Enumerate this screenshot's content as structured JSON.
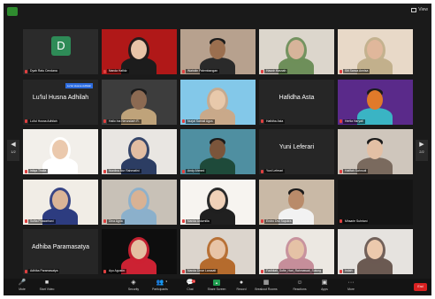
{
  "topbar": {
    "view_label": "View"
  },
  "tiles": [
    {
      "name": "Dyah Ratu Cendana",
      "style": "avatar",
      "avatar_letter": "D",
      "avatar_color": "#2e8b57"
    },
    {
      "name": "Nanda Hafidz",
      "style": "video",
      "bg": "#b01818",
      "skin": "#e7c4a8",
      "cloth": "#1c1c1c",
      "hijab": true
    },
    {
      "name": "Wahidin Palembangan",
      "style": "video",
      "bg": "#b7a18e",
      "skin": "#9b6f4f",
      "cloth": "#2a2a2a"
    },
    {
      "name": "Hasnir Hasnah",
      "style": "video",
      "bg": "#dcd6cc",
      "skin": "#d7b49a",
      "cloth": "#6e8f5a",
      "hijab": true
    },
    {
      "name": "Siti Sanca Annisa",
      "style": "video",
      "bg": "#e8d9c8",
      "skin": "#e0b79b",
      "cloth": "#c2b08c",
      "hijab": true
    },
    {
      "name": "Lu'lul Husna Adhilah",
      "style": "name",
      "tag": "Lu'lul Husna Adhilah",
      "label": "Lu'lul Husna Adhilah"
    },
    {
      "name": "Hallo Ina Nerundarh R.",
      "style": "video",
      "bg": "#3d3d3d",
      "skin": "#8c6a52",
      "cloth": "#bfa37a"
    },
    {
      "name": "Nurjal Satriali Agus",
      "style": "video",
      "bg": "#83c8e9",
      "skin": "#e8c9ab",
      "cloth": "#c9a98a",
      "hijab": true
    },
    {
      "name": "Hafidha Asta",
      "style": "name",
      "label": "Hafidha Asta"
    },
    {
      "name": "Hertia Haryati",
      "style": "video",
      "bg": "#5a2a8a",
      "skin": "#e07a2a",
      "cloth": "#3ab4c4"
    },
    {
      "name": "Istiqa Thalia",
      "style": "video",
      "bg": "#f2efea",
      "skin": "#ebc9ad",
      "cloth": "#ffffff",
      "hijab": true
    },
    {
      "name": "Nurdina Nur Rahmatini",
      "style": "video",
      "bg": "#e9e6e2",
      "skin": "#e2bda2",
      "cloth": "#2c3d63",
      "hijab": true
    },
    {
      "name": "Andy Ahmed",
      "style": "video",
      "bg": "#4f8fa1",
      "skin": "#7b553b",
      "cloth": "#1e4a3a"
    },
    {
      "name": "Yuni Leferari",
      "style": "name",
      "label": "Yuni Leferari"
    },
    {
      "name": "Hafifah Sahrouti",
      "style": "video",
      "bg": "#cfc6bc",
      "skin": "#e3c0a5",
      "cloth": "#7a6a5e"
    },
    {
      "name": "Sulfia Prawarhani",
      "style": "video",
      "bg": "#f1ede6",
      "skin": "#dbb597",
      "cloth": "#2d3c80",
      "hijab": true
    },
    {
      "name": "Dina Agria",
      "style": "video",
      "bg": "#c8c1b7",
      "skin": "#d8b294",
      "cloth": "#8bb0cb",
      "hijab": true
    },
    {
      "name": "Nanda Asturnilla",
      "style": "video",
      "bg": "#f7f4f0",
      "skin": "#f0d1b8",
      "cloth": "#202020",
      "hijab": true
    },
    {
      "name": "Endro Dwi Saputra",
      "style": "video",
      "bg": "#c9b9a6",
      "skin": "#b98b6a",
      "cloth": "#f2f2f2"
    },
    {
      "name": "Mhsarie Suhriani",
      "style": "dark"
    },
    {
      "name": "Adhiba Paramasatya",
      "style": "name",
      "label": "Adhiba Paramasatya"
    },
    {
      "name": "Ayu Agustin",
      "style": "video",
      "bg": "#0e0e0e",
      "skin": "#e4c0a2",
      "cloth": "#cc2233",
      "hijab": true
    },
    {
      "name": "Nanda Dinar Larasati",
      "style": "video",
      "bg": "#dcd5cd",
      "skin": "#e8c4a6",
      "cloth": "#b56b2d",
      "hijab": true
    },
    {
      "name": "Fadhilah_Sofie_Hari_Rahmawati_Sulung",
      "style": "video",
      "bg": "#ece8e2",
      "skin": "#e5c2a6",
      "cloth": "#c68e9a",
      "hijab": true
    },
    {
      "name": "Indah",
      "style": "video",
      "bg": "#e6e3df",
      "skin": "#ecc9ad",
      "cloth": "#6b5a52",
      "hijab": true
    }
  ],
  "pager": {
    "left_page": "1/2",
    "right_page": "2/2",
    "left_glyph": "◀",
    "right_glyph": "▶"
  },
  "toolbar": {
    "items": [
      {
        "label": "Mute",
        "icon": "microphone-icon",
        "glyph": "🎤"
      },
      {
        "label": "Start Video",
        "icon": "video-camera-icon",
        "glyph": "■"
      },
      {
        "label": "Security",
        "icon": "shield-icon",
        "glyph": "◈"
      },
      {
        "label": "Participants",
        "icon": "participants-icon",
        "glyph": "👥"
      },
      {
        "label": "Chat",
        "icon": "chat-icon",
        "glyph": "💬"
      },
      {
        "label": "Share Screen",
        "icon": "share-screen-icon",
        "glyph": "▲"
      },
      {
        "label": "Record",
        "icon": "record-icon",
        "glyph": "●"
      },
      {
        "label": "Breakout Rooms",
        "icon": "breakout-rooms-icon",
        "glyph": "▦"
      },
      {
        "label": "Reactions",
        "icon": "reactions-icon",
        "glyph": "☺"
      },
      {
        "label": "Apps",
        "icon": "apps-icon",
        "glyph": "▣"
      },
      {
        "label": "More",
        "icon": "more-icon",
        "glyph": "···"
      }
    ],
    "participants_count": "3",
    "chat_badge": "1",
    "end_label": "End",
    "end_color": "#d92121"
  }
}
